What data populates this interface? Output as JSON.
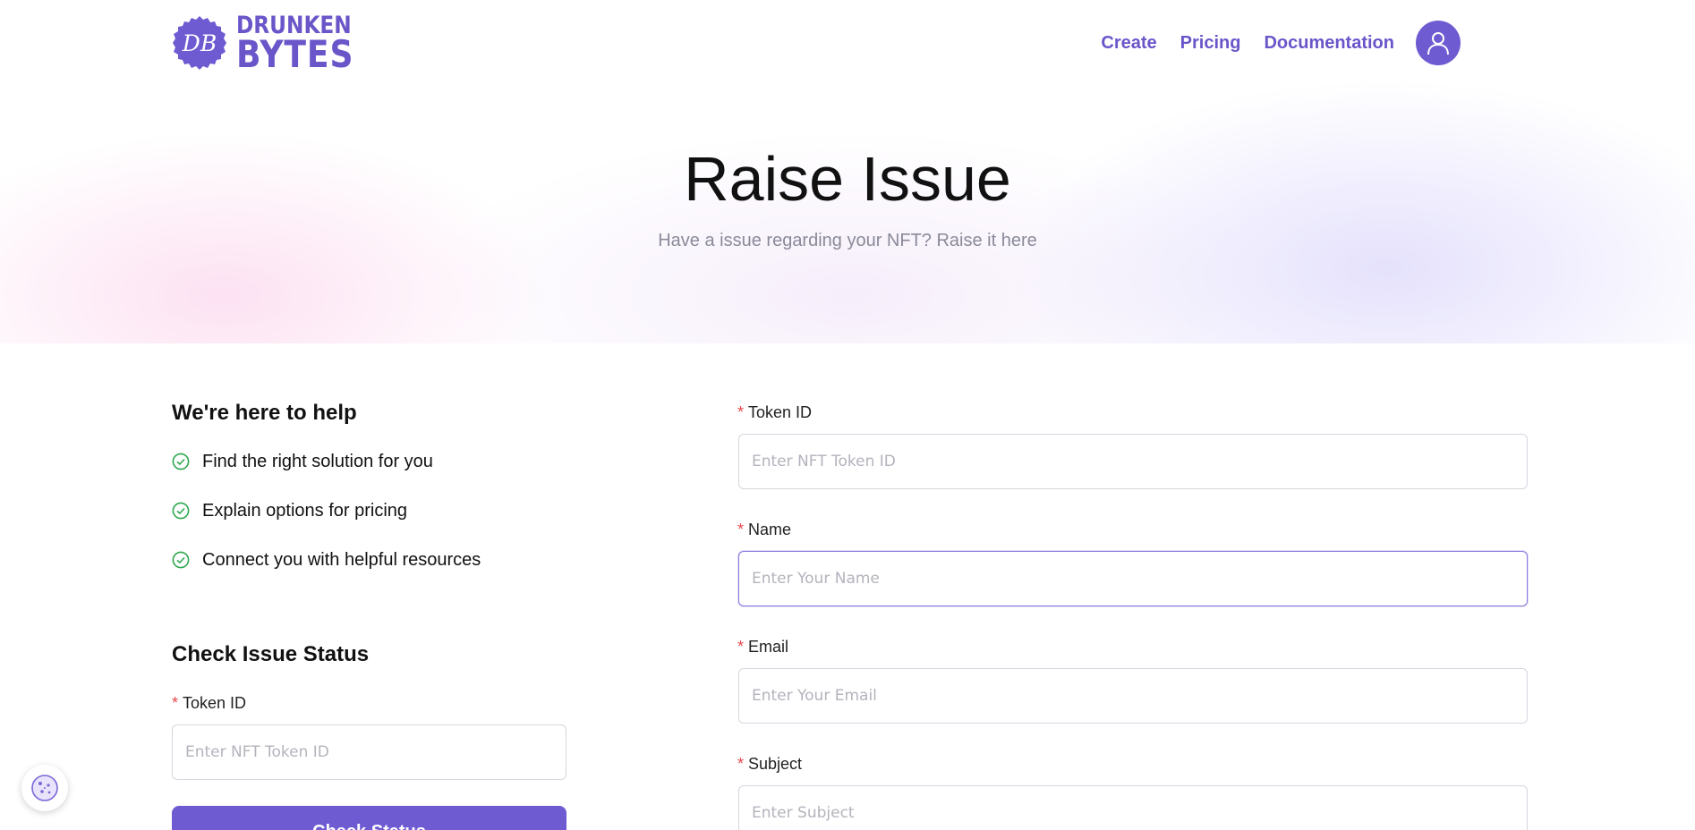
{
  "header": {
    "logo": {
      "monogram": "DB",
      "line1": "DRUNKEN",
      "line2": "BYTES",
      "icon": "db-logo-badge"
    },
    "nav": [
      {
        "label": "Create"
      },
      {
        "label": "Pricing"
      },
      {
        "label": "Documentation"
      }
    ],
    "avatar_icon": "user-icon"
  },
  "hero": {
    "title": "Raise Issue",
    "subtitle": "Have a issue regarding your NFT? Raise it here"
  },
  "help": {
    "title": "We're here to help",
    "items": [
      {
        "text": "Find the right solution for you",
        "icon": "check-circle-icon"
      },
      {
        "text": "Explain options for pricing",
        "icon": "check-circle-icon"
      },
      {
        "text": "Connect you with helpful resources",
        "icon": "check-circle-icon"
      }
    ]
  },
  "status": {
    "title": "Check Issue Status",
    "token_label": "Token ID",
    "token_placeholder": "Enter NFT Token ID",
    "button_label": "Check Status"
  },
  "form": {
    "required_mark": "*",
    "fields": [
      {
        "label": "Token ID",
        "placeholder": "Enter NFT Token ID",
        "value": ""
      },
      {
        "label": "Name",
        "placeholder": "Enter Your Name",
        "value": ""
      },
      {
        "label": "Email",
        "placeholder": "Enter Your Email",
        "value": ""
      },
      {
        "label": "Subject",
        "placeholder": "Enter Subject",
        "value": ""
      }
    ]
  },
  "cookie_icon": "cookie-icon",
  "colors": {
    "accent": "#6e5bd2",
    "brand_text": "#6a55c9",
    "required": "#e5484d",
    "check": "#2fa84f"
  }
}
